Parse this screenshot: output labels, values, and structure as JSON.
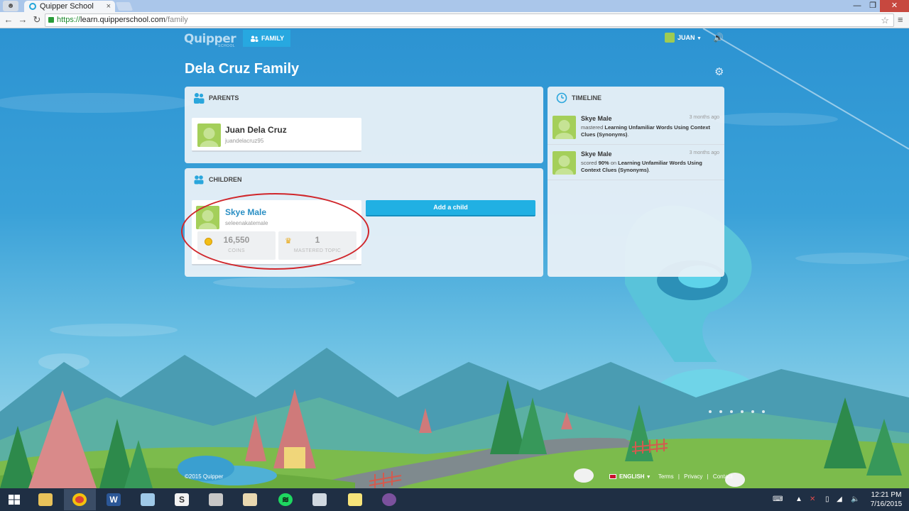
{
  "browser": {
    "tab_title": "Quipper School",
    "url_https": "https://",
    "url_host": "learn.quipperschool.com",
    "url_path": "/family"
  },
  "site": {
    "logo": "Quipper",
    "logo_sub": "SCHOOL",
    "nav_tab": "FAMILY",
    "user_name": "JUAN"
  },
  "page_title": "Dela Cruz Family",
  "parents": {
    "heading": "PARENTS",
    "members": [
      {
        "name": "Juan Dela Cruz",
        "username": "juandelacruz95"
      }
    ]
  },
  "children": {
    "heading": "CHILDREN",
    "members": [
      {
        "name": "Skye Male",
        "username": "seleenakatemale",
        "coins_value": "16,550",
        "coins_label": "COINS",
        "mastered_value": "1",
        "mastered_label": "MASTERED TOPIC"
      }
    ],
    "add_button": "Add a child"
  },
  "timeline": {
    "heading": "TIMELINE",
    "items": [
      {
        "name": "Skye Male",
        "time": "3 months ago",
        "action": "mastered",
        "topic": "Learning Unfamiliar Words Using Context Clues (Synonyms)",
        "tail": "."
      },
      {
        "name": "Skye Male",
        "time": "3 months ago",
        "action": "scored",
        "score": "90%",
        "on": "on",
        "topic": "Learning Unfamiliar Words Using Context Clues (Synonyms)",
        "tail": "."
      }
    ]
  },
  "footer": {
    "copyright": "©2015 Quipper",
    "language": "ENGLISH",
    "links": [
      "Terms",
      "Privacy",
      "Contact"
    ],
    "separator": "|"
  },
  "taskbar": {
    "apps": [
      "file-explorer",
      "chrome",
      "word",
      "notepad",
      "slack",
      "calculator",
      "paint",
      "spotify",
      "snipping-tool",
      "sticky-notes",
      "viber"
    ],
    "time": "12:21 PM",
    "date": "7/16/2015"
  },
  "colors": {
    "accent": "#21b0e3",
    "avatar_green": "#a4cf5a",
    "highlight_red": "#d0262b"
  }
}
